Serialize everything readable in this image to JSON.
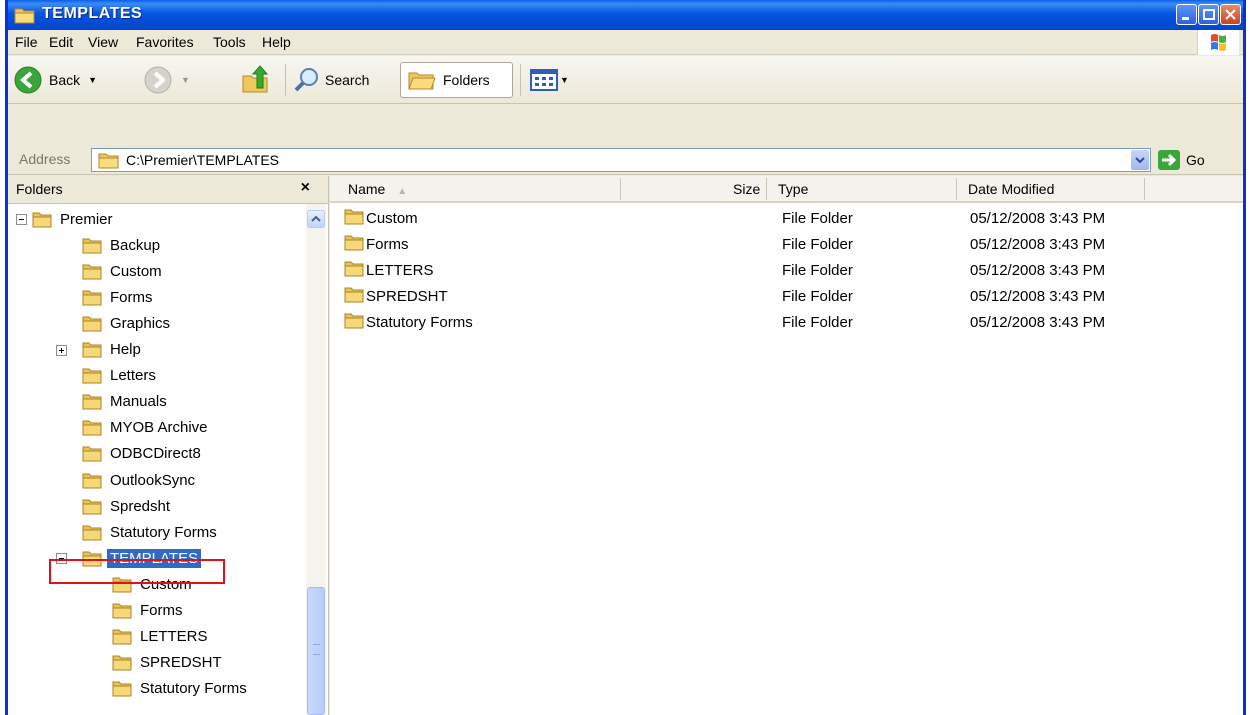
{
  "window": {
    "title": "TEMPLATES",
    "colors": {
      "titlebar": "#0554e3",
      "selection": "#316ac5",
      "highlight_outline": "#e0111b",
      "folder": "#f0c85a"
    }
  },
  "menu": [
    "File",
    "Edit",
    "View",
    "Favorites",
    "Tools",
    "Help"
  ],
  "toolbar": {
    "back_label": "Back",
    "search_label": "Search",
    "folders_label": "Folders"
  },
  "address": {
    "label": "Address",
    "path": "C:\\Premier\\TEMPLATES",
    "go_label": "Go"
  },
  "folders_pane": {
    "title": "Folders",
    "close_glyph": "×",
    "tree": [
      {
        "label": "Premier",
        "level": 0,
        "expander": "minus"
      },
      {
        "label": "Backup",
        "level": 1,
        "expander": "none"
      },
      {
        "label": "Custom",
        "level": 1,
        "expander": "none"
      },
      {
        "label": "Forms",
        "level": 1,
        "expander": "none"
      },
      {
        "label": "Graphics",
        "level": 1,
        "expander": "none"
      },
      {
        "label": "Help",
        "level": 1,
        "expander": "plus"
      },
      {
        "label": "Letters",
        "level": 1,
        "expander": "none"
      },
      {
        "label": "Manuals",
        "level": 1,
        "expander": "none"
      },
      {
        "label": "MYOB Archive",
        "level": 1,
        "expander": "none"
      },
      {
        "label": "ODBCDirect8",
        "level": 1,
        "expander": "none"
      },
      {
        "label": "OutlookSync",
        "level": 1,
        "expander": "none"
      },
      {
        "label": "Spredsht",
        "level": 1,
        "expander": "none"
      },
      {
        "label": "Statutory Forms",
        "level": 1,
        "expander": "none"
      },
      {
        "label": "TEMPLATES",
        "level": 1,
        "expander": "minus",
        "selected": true
      },
      {
        "label": "Custom",
        "level": 2,
        "expander": "none"
      },
      {
        "label": "Forms",
        "level": 2,
        "expander": "none"
      },
      {
        "label": "LETTERS",
        "level": 2,
        "expander": "none"
      },
      {
        "label": "SPREDSHT",
        "level": 2,
        "expander": "none"
      },
      {
        "label": "Statutory Forms",
        "level": 2,
        "expander": "none"
      }
    ]
  },
  "file_list": {
    "columns": {
      "name": "Name",
      "size": "Size",
      "type": "Type",
      "date": "Date Modified"
    },
    "rows": [
      {
        "name": "Custom",
        "size": "",
        "type": "File Folder",
        "date": "05/12/2008 3:43 PM"
      },
      {
        "name": "Forms",
        "size": "",
        "type": "File Folder",
        "date": "05/12/2008 3:43 PM"
      },
      {
        "name": "LETTERS",
        "size": "",
        "type": "File Folder",
        "date": "05/12/2008 3:43 PM"
      },
      {
        "name": "SPREDSHT",
        "size": "",
        "type": "File Folder",
        "date": "05/12/2008 3:43 PM"
      },
      {
        "name": "Statutory Forms",
        "size": "",
        "type": "File Folder",
        "date": "05/12/2008 3:43 PM"
      }
    ]
  }
}
